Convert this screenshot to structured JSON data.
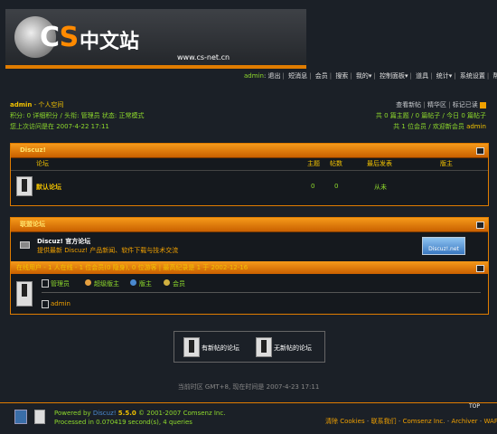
{
  "banner": {
    "logo_c": "C",
    "logo_s": "S",
    "title_cn": "中文站",
    "url": "www.cs-net.cn"
  },
  "nav": {
    "username": "admin",
    "items": [
      "退出",
      "短消息",
      "会员",
      "搜索",
      "我的",
      "控制面板",
      "道具",
      "统计",
      "系统设置",
      "帮助"
    ]
  },
  "user": {
    "name": "admin",
    "space": "个人空间",
    "line2": "积分: 0 详细积分 / 头衔: 管理员 状态: 正常模式",
    "line3": "您上次访问是在 2007-4-22 17:11"
  },
  "right_info": {
    "line1": [
      "查看新帖",
      "精华区",
      "标记已读"
    ],
    "line2": "共 0 篇主题 / 0 篇帖子 / 今日 0 篇帖子",
    "line3_prefix": "共 1 位会员 / 欢迎新会员",
    "line3_user": "admin"
  },
  "forum_panel": {
    "title": "Discuz!",
    "columns": {
      "forum": "论坛",
      "topics": "主题",
      "posts": "帖数",
      "last": "最后发表",
      "mod": "版主"
    },
    "row": {
      "name": "默认论坛",
      "topics": "0",
      "posts": "0",
      "last": "从未"
    }
  },
  "union_panel": {
    "title": "联盟论坛",
    "name": "Discuz! 官方论坛",
    "desc": "提供最新 Discuz! 产品新闻、软件下载与技术交流",
    "badge": "Discuz!.net"
  },
  "online": {
    "header": "在线用户 - 1 人在线 - 1 位会员(0 隐身), 0 位游客 | 最高纪录是 1 于 2002-12-16",
    "legend": [
      "管理员",
      "超级版主",
      "版主",
      "会员"
    ],
    "users": [
      "admin"
    ]
  },
  "bottom_links": {
    "new": "有新帖的论坛",
    "nonew": "无新帖的论坛"
  },
  "timezone": "当前时区 GMT+8, 现在时间是 2007-4-23 17:11",
  "footer": {
    "line1_prefix": "Powered by",
    "product": "Discuz!",
    "version": "5.5.0",
    "copyright": "© 2001-2007 Comsenz Inc.",
    "line2": "Processed in 0.070419 second(s), 4 queries",
    "top": "TOP",
    "right_links": [
      "清除 Cookies",
      "联系我们",
      "Comsenz Inc.",
      "Archiver",
      "WAP"
    ]
  }
}
